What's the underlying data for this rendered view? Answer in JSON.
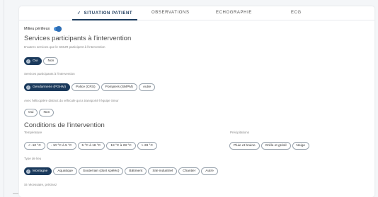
{
  "tabs": [
    {
      "label": "SITUATION PATIENT",
      "active": true
    },
    {
      "label": "OBSERVATIONS",
      "active": false
    },
    {
      "label": "ECHOGRAPHIE",
      "active": false
    },
    {
      "label": "ECG",
      "active": false
    }
  ],
  "milieu_perilleux": {
    "label": "Milieu périlleux",
    "enabled": true
  },
  "services": {
    "title": "Services participants à l'intervention",
    "subtitle": "D'autres services que le SMUR participent à l'intervention",
    "oui_non": [
      {
        "label": "Oui",
        "selected": true
      },
      {
        "label": "Non",
        "selected": false
      }
    ],
    "participants_label": "Services participants à l'intervention",
    "participants": [
      {
        "label": "Gendarmerie (PGHM)",
        "selected": true
      },
      {
        "label": "Police (CRS)",
        "selected": false
      },
      {
        "label": "Pompiers (SMPM)",
        "selected": false
      },
      {
        "label": "Autre",
        "selected": false
      }
    ],
    "helicopter_label": "Avec hélicoptère distinct du véhicule qui a transporté l'équipe Smur",
    "helicopter": [
      {
        "label": "Oui",
        "selected": false
      },
      {
        "label": "Non",
        "selected": false
      }
    ]
  },
  "conditions": {
    "title": "Conditions de l'intervention",
    "temperature_label": "Température",
    "temperature": [
      {
        "label": "< -10 °C",
        "selected": false
      },
      {
        "label": "- 10 °C à 5 °C",
        "selected": false
      },
      {
        "label": "5 °C à 18 °C",
        "selected": false
      },
      {
        "label": "18 °C à 28 °C",
        "selected": false
      },
      {
        "label": "> 28 °C",
        "selected": false
      }
    ],
    "precipitations_label": "Précipitations",
    "precipitations": [
      {
        "label": "Pluie et bruine",
        "selected": false
      },
      {
        "label": "Grêle et grésil",
        "selected": false
      },
      {
        "label": "Neige",
        "selected": false
      }
    ],
    "lieu_label": "Type de lieu",
    "lieu": [
      {
        "label": "Montagne",
        "selected": true
      },
      {
        "label": "Aquatique",
        "selected": false
      },
      {
        "label": "Souterrain (dont spéléo)",
        "selected": false
      },
      {
        "label": "Bâtiment",
        "selected": false
      },
      {
        "label": "Site industriel",
        "selected": false
      },
      {
        "label": "Chantier",
        "selected": false
      },
      {
        "label": "Autre",
        "selected": false
      }
    ],
    "precisez_label": "Si nécessaire, précisez"
  },
  "colors": {
    "accent": "#1b3a5c",
    "toggle": "#4a90d9"
  },
  "icons": {
    "tab_active": "check-icon",
    "chip_selected": "check-circle-icon"
  }
}
